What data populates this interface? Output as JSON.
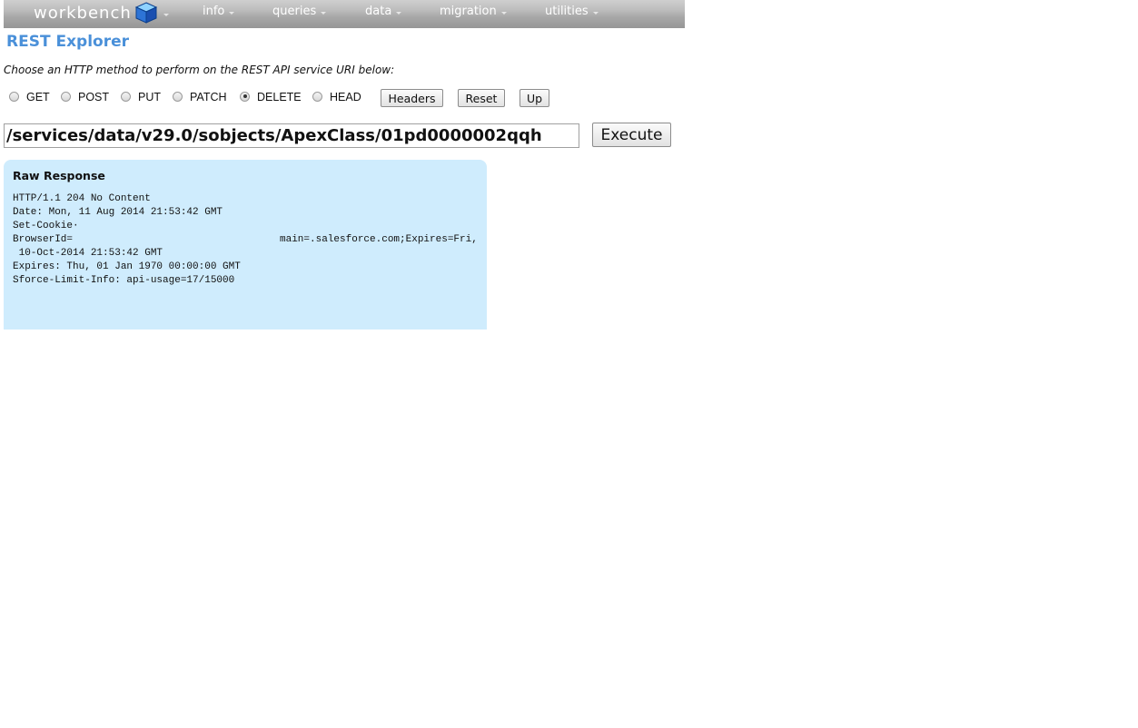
{
  "nav": {
    "logo": "workbench",
    "items": [
      {
        "label": "info"
      },
      {
        "label": "queries"
      },
      {
        "label": "data"
      },
      {
        "label": "migration"
      },
      {
        "label": "utilities"
      }
    ]
  },
  "page": {
    "title": "REST Explorer",
    "instructions": "Choose an HTTP method to perform on the REST API service URI below:"
  },
  "methods": [
    {
      "label": "GET",
      "checked": false
    },
    {
      "label": "POST",
      "checked": false
    },
    {
      "label": "PUT",
      "checked": false
    },
    {
      "label": "PATCH",
      "checked": false
    },
    {
      "label": "DELETE",
      "checked": true
    },
    {
      "label": "HEAD",
      "checked": false
    }
  ],
  "buttons": {
    "headers": "Headers",
    "reset": "Reset",
    "up": "Up",
    "execute": "Execute"
  },
  "uri": {
    "value": "/services/data/v29.0/sobjects/ApexClass/01pd0000002qqh"
  },
  "response": {
    "heading": "Raw Response",
    "lines": [
      "HTTP/1.1 204 No Content",
      "Date: Mon, 11 Aug 2014 21:53:42 GMT",
      "Set-Cookie·",
      "BrowserId=",
      " 10-Oct-2014 21:53:42 GMT",
      "Expires: Thu, 01 Jan 1970 00:00:00 GMT",
      "Sforce-Limit-Info: api-usage=17/15000"
    ],
    "cookie_tail": "main=.salesforce.com;Expires=Fri,"
  }
}
